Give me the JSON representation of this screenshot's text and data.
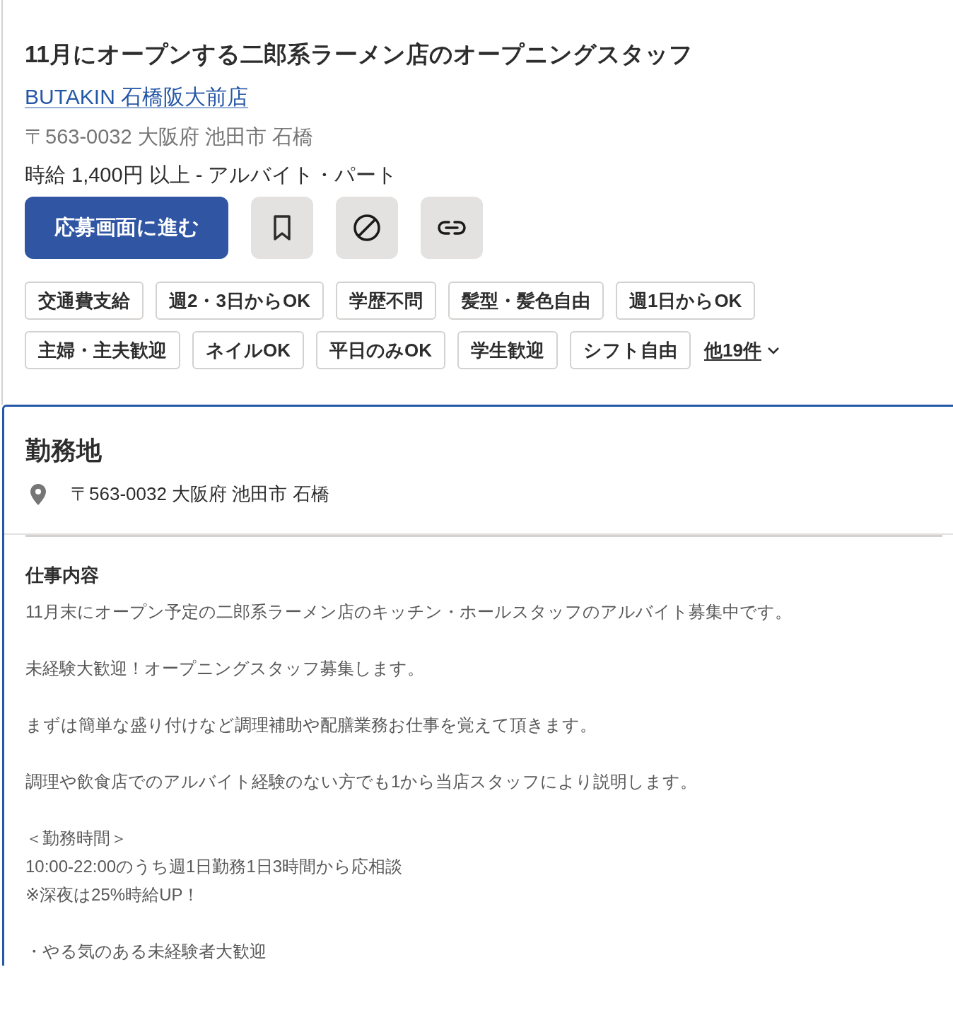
{
  "job": {
    "title": "11月にオープンする二郎系ラーメン店のオープニングスタッフ",
    "company": "BUTAKIN 石橋阪大前店",
    "address": "〒563-0032 大阪府 池田市 石橋",
    "salary": "時給 1,400円 以上  - アルバイト・パート",
    "apply_button": "応募画面に進む",
    "icon_buttons": [
      {
        "kind": "bookmark"
      },
      {
        "kind": "block"
      },
      {
        "kind": "link"
      }
    ],
    "tags": [
      "交通費支給",
      "週2・3日からOK",
      "学歴不問",
      "髪型・髪色自由",
      "週1日からOK",
      "主婦・主夫歓迎",
      "ネイルOK",
      "平日のみOK",
      "学生歓迎",
      "シフト自由"
    ],
    "more_tags": {
      "label": "他19件",
      "expanded": false
    }
  },
  "location": {
    "heading": "勤務地",
    "address": "〒563-0032 大阪府 池田市 石橋"
  },
  "description": {
    "heading": "仕事内容",
    "paragraphs": [
      [
        "11月末にオープン予定の二郎系ラーメン店のキッチン・ホールスタッフのアルバイト募集中です。"
      ],
      [
        "未経験大歓迎！オープニングスタッフ募集します。"
      ],
      [
        "まずは簡単な盛り付けなど調理補助や配膳業務お仕事を覚えて頂きます。"
      ],
      [
        "調理や飲食店でのアルバイト経験のない方でも1から当店スタッフにより説明します。"
      ],
      [
        "＜勤務時間＞",
        "10:00-22:00のうち週1日勤務1日3時間から応相談",
        "※深夜は25%時給UP！"
      ],
      [
        "・やる気のある未経験者大歓迎"
      ]
    ]
  }
}
